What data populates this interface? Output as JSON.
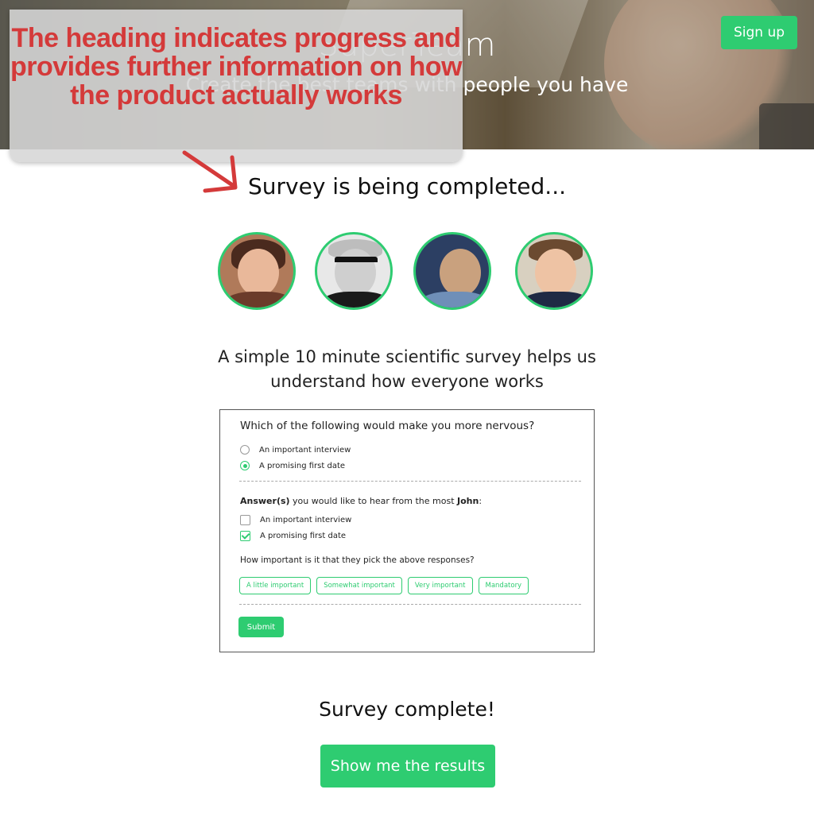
{
  "header": {
    "title": "SuperTeam",
    "subtitle": "Create the best teams with people you have",
    "signup_label": "Sign up"
  },
  "annotation": {
    "text": "The heading indicates progress and provides further information on how the product actually works"
  },
  "main": {
    "heading": "Survey is being completed...",
    "intro": "A simple 10 minute scientific survey helps us understand how everyone works"
  },
  "survey": {
    "question1": "Which of the following would make you more nervous?",
    "q1_options": [
      "An important interview",
      "A promising first date"
    ],
    "q1_selected": 1,
    "question2_prefix": "Answer(s)",
    "question2_middle": " you would like to hear from the most ",
    "question2_name": "John",
    "question2_suffix": ":",
    "q2_options": [
      "An important interview",
      "A promising first date"
    ],
    "q2_checked": [
      false,
      true
    ],
    "question3": "How important is it that they pick the above responses?",
    "importance": [
      "A little important",
      "Somewhat important",
      "Very important",
      "Mandatory"
    ],
    "submit_label": "Submit"
  },
  "completion": {
    "text": "Survey complete!",
    "results_label": "Show me the results"
  },
  "colors": {
    "accent": "#2ecc71",
    "annotation_text": "#d43a3a"
  }
}
